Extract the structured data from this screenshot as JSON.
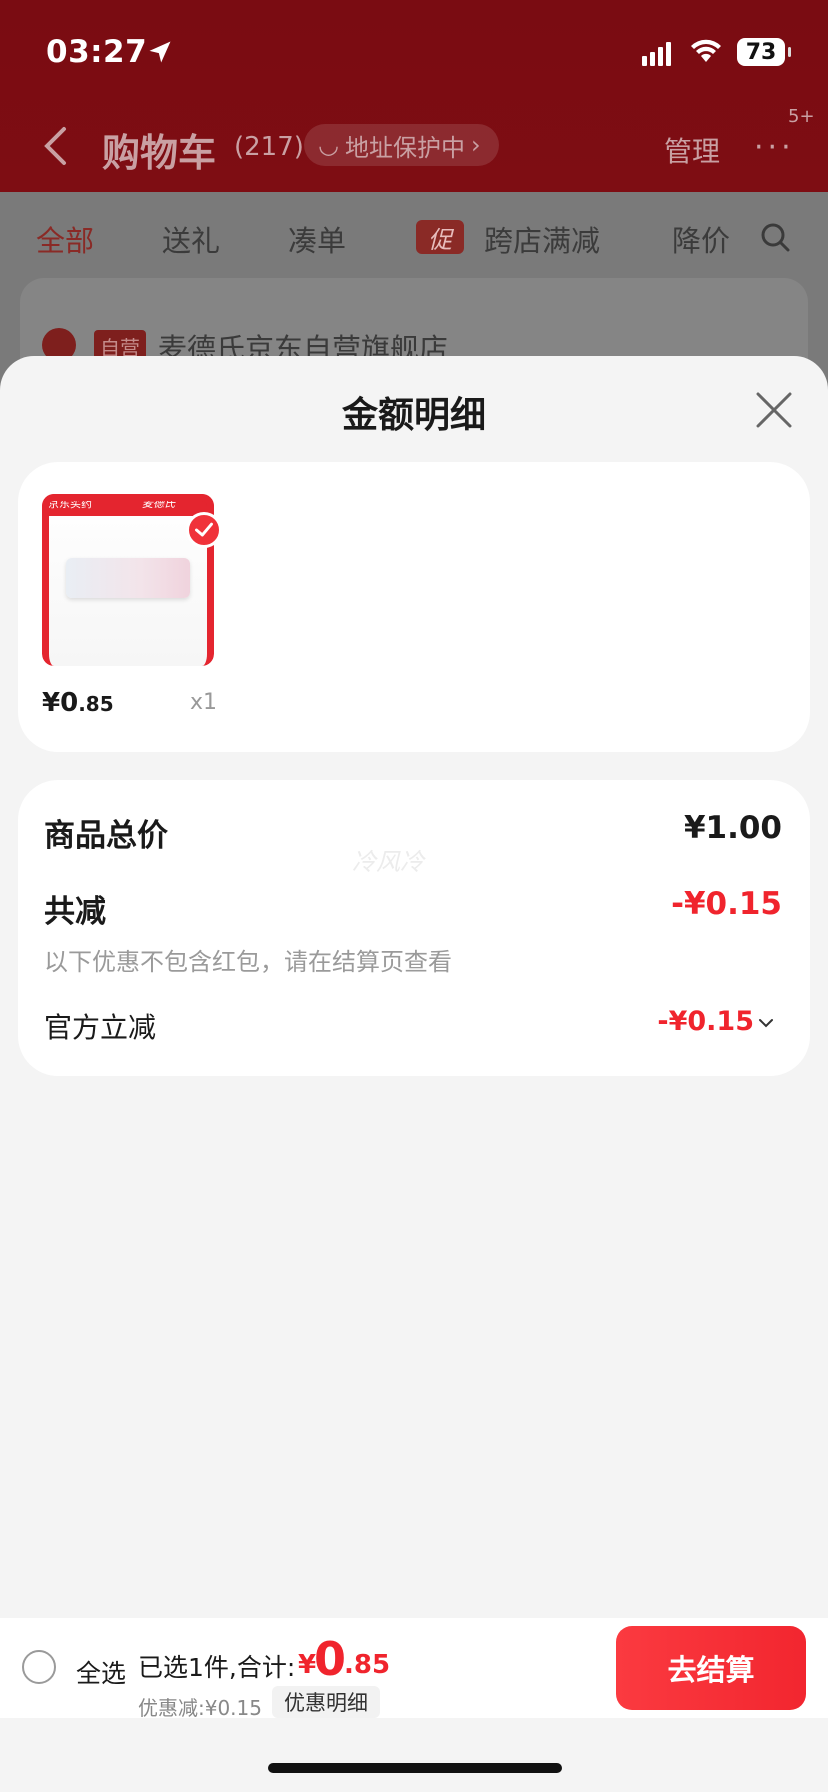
{
  "status_bar": {
    "time": "03:27",
    "battery": "73"
  },
  "nav": {
    "title": "购物车",
    "count": "(217)",
    "address_protection": "地址保护中",
    "manage": "管理",
    "more_badge": "5+"
  },
  "filters": [
    "全部",
    "送礼",
    "凑单",
    "跨店满减",
    "降价"
  ],
  "promo_tag": "促",
  "store": {
    "self_tag": "自营",
    "name": "麦德氏京东自营旗舰店"
  },
  "sheet": {
    "title": "金额明细",
    "product": {
      "thumb_brand": "京东买药",
      "thumb_brand2": "麦德氏",
      "price_symbol": "¥0",
      "price_decimal": ".85",
      "quantity": "x1"
    },
    "summary": {
      "total_label": "商品总价",
      "total_value": "¥1.00",
      "discount_label": "共减",
      "discount_value": "-¥0.15",
      "note": "以下优惠不包含红包，请在结算页查看",
      "official_label": "官方立减",
      "official_value": "-¥0.15",
      "watermark": "冷风冷"
    }
  },
  "bottom_bar": {
    "select_all": "全选",
    "selected_summary": "已选1件,合计:",
    "total_yen": "¥",
    "total_int": "0",
    "total_dec": ".85",
    "discount_text": "优惠减:¥0.15",
    "detail_chip": "优惠明细",
    "checkout": "去结算"
  },
  "colors": {
    "accent": "#f0242d",
    "header_dim": "#7a0c12"
  }
}
